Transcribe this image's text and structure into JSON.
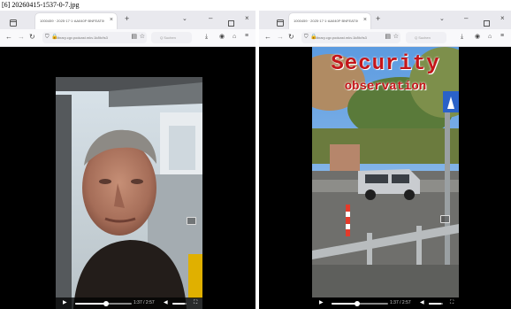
{
  "caption": "[6] 20260415-1537-0-7.jpg",
  "left_window": {
    "tab_title": "1000459 · 2025·17·1·AA040F·BNFEAT000 · TSJCAVBG0B",
    "url_text": "library.cgv.podcast.mkv.1k/lib/ts3",
    "search_placeholder": "Q  Suchen",
    "time": "1:37 / 2:57"
  },
  "right_window": {
    "tab_title": "1000459 · 2025·17·1·AA040F·BNFEAT000 · TSJCAVBG0B",
    "url_text": "library.cgv.podcast.mkv.1k/lib/ts3",
    "search_placeholder": "Q  Suchen",
    "time": "1:37 / 2:57",
    "overlay_line1": "Security",
    "overlay_line2": "observation"
  },
  "video_progress": {
    "left": 0.55,
    "right": 0.45
  },
  "icons": {
    "tab_overview": "tab-overview-icon",
    "new_tab": "plus-icon",
    "dropdown": "chevron-down-icon",
    "minimize": "minimize-icon",
    "maximize": "maximize-icon",
    "close": "close-icon",
    "back": "back-arrow-icon",
    "forward": "forward-arrow-icon",
    "reload": "reload-icon",
    "shield": "shield-icon",
    "lock": "lock-icon",
    "reader": "reader-view-icon",
    "bookmark": "star-icon",
    "downloads": "download-icon",
    "account": "account-icon",
    "extensions": "extensions-icon",
    "play": "play-icon",
    "volume": "volume-icon",
    "fullscreen": "fullscreen-icon",
    "pip": "picture-in-picture-icon"
  },
  "colors": {
    "overlay_text": "#c4161a",
    "tabbar": "#e9e9ee",
    "video_bg": "#000000"
  }
}
